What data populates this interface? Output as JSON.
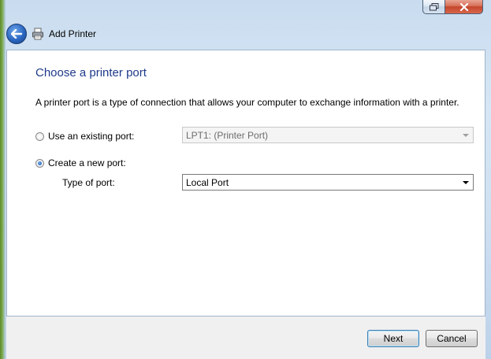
{
  "window": {
    "title": "Add Printer"
  },
  "icons": {
    "back": "back-arrow-icon",
    "printer": "printer-icon",
    "restore": "restore-icon",
    "close": "close-icon"
  },
  "page": {
    "heading": "Choose a printer port",
    "description": "A printer port is a type of connection that allows your computer to exchange information with a printer."
  },
  "options": {
    "existing_label": "Use an existing port:",
    "existing_value": "LPT1: (Printer Port)",
    "new_label": "Create a new port:",
    "type_label": "Type of port:",
    "type_value": "Local Port",
    "selected": "new"
  },
  "buttons": {
    "next": "Next",
    "cancel": "Cancel"
  },
  "colors": {
    "heading": "#1e3a8a",
    "close_button": "#c2462d"
  }
}
